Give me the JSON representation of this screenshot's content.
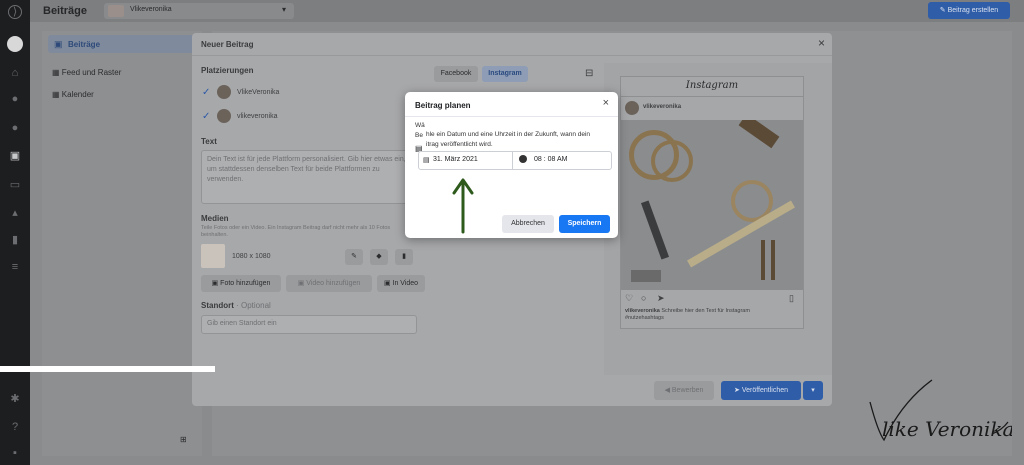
{
  "topbar": {
    "title": "Beiträge",
    "account_name": "Vlikeveronika",
    "create_button": "Beitrag erstellen"
  },
  "nav": {
    "items": [
      {
        "label": "Beiträge",
        "selected": true
      },
      {
        "label": "Feed und Raster"
      },
      {
        "label": "Kalender"
      }
    ]
  },
  "modal": {
    "title": "Neuer Beitrag",
    "placements_label": "Platzierungen",
    "accounts": [
      {
        "name": "VlikeVeronika",
        "network": "facebook"
      },
      {
        "name": "vlikeveronika",
        "network": "instagram"
      }
    ],
    "text_label": "Text",
    "text_placeholder": "Dein Text ist für jede Plattform personalisiert. Gib hier etwas ein, um stattdessen denselben Text für beide Plattformen zu verwenden.",
    "media_label": "Medien",
    "media_hint": "Teile Fotos oder ein Video. Ein Instagram Beitrag darf nicht mehr als 10 Fotos beinhalten.",
    "media_size": "1080 x 1080",
    "add_photo": "Foto hinzufügen",
    "add_video": "Video hinzufügen",
    "in_video": "In Video",
    "location_label": "Standort",
    "location_optional": "· Optional",
    "location_placeholder": "Gib einen Standort ein",
    "tabs": [
      "Facebook",
      "Instagram"
    ],
    "active_tab": "Instagram",
    "promote_button": "Bewerben",
    "publish_button": "Veröffentlichen"
  },
  "preview": {
    "logo": "Instagram",
    "username": "vlikeveronika",
    "caption_user": "vlikeveronika",
    "caption_text": "Schreibe hier den Text für Instagram",
    "hashtags": "#nutzehashtags"
  },
  "dialog": {
    "title": "Beitrag planen",
    "desc_line1_start": "Wä",
    "desc_line1": "hle ein Datum und eine Uhrzeit in der Zukunft, wann dein",
    "desc_line2_start": "Be",
    "desc_line2": "itrag veröffentlicht wird.",
    "date": "31. März 2021",
    "time": "08 : 08 AM",
    "cancel": "Abbrechen",
    "save": "Speichern"
  },
  "watermark": "Vlike Veronika",
  "colors": {
    "primary_blue": "#1877f2",
    "arrow_green": "#2e5a1c"
  }
}
